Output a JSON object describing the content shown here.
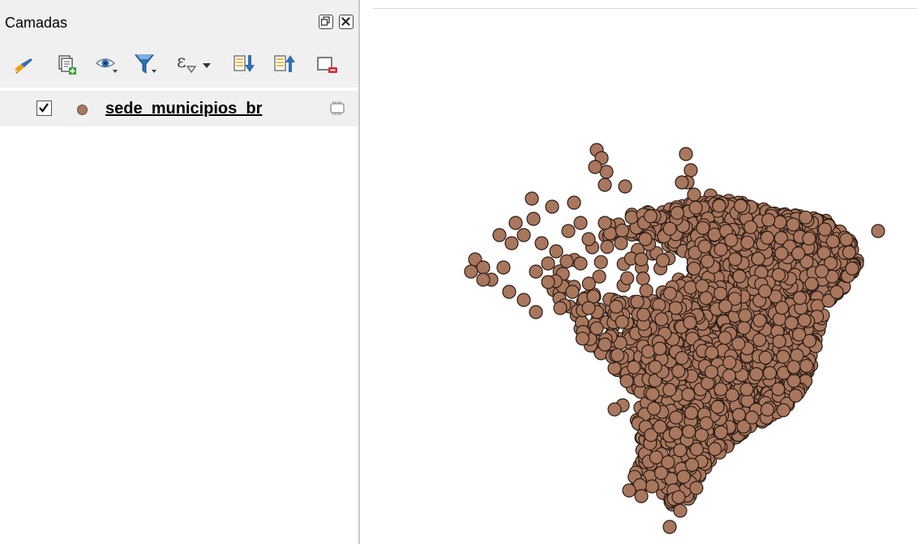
{
  "layers_panel": {
    "title": "Camadas",
    "header_buttons": [
      {
        "name": "float-panel",
        "icon": "restore-icon"
      },
      {
        "name": "close-panel",
        "icon": "close-icon"
      }
    ],
    "toolbar": [
      {
        "name": "style-manager",
        "icon": "paintbrush-icon"
      },
      {
        "name": "add-group",
        "icon": "add-group-icon"
      },
      {
        "name": "manage-visibility",
        "icon": "eye-icon"
      },
      {
        "name": "filter-legend",
        "icon": "funnel-icon"
      },
      {
        "name": "filter-by-expression",
        "icon": "expression-icon"
      },
      {
        "name": "expand-all",
        "icon": "expand-all-icon"
      },
      {
        "name": "collapse-all",
        "icon": "collapse-all-icon"
      },
      {
        "name": "remove-layer",
        "icon": "remove-layer-icon"
      }
    ],
    "layers": [
      {
        "name": "sede_municipios_br",
        "checked": true,
        "symbol_color": "#a87860"
      }
    ]
  },
  "map": {
    "point_fill": "#a8775e",
    "point_stroke": "#2a1b14",
    "background": "#ffffff"
  },
  "colors": {
    "panel_bg": "#f0f0f0",
    "accent_orange": "#e8a21a",
    "accent_blue": "#2f6fb5",
    "accent_green": "#33a33a",
    "accent_red": "#d6283a"
  }
}
